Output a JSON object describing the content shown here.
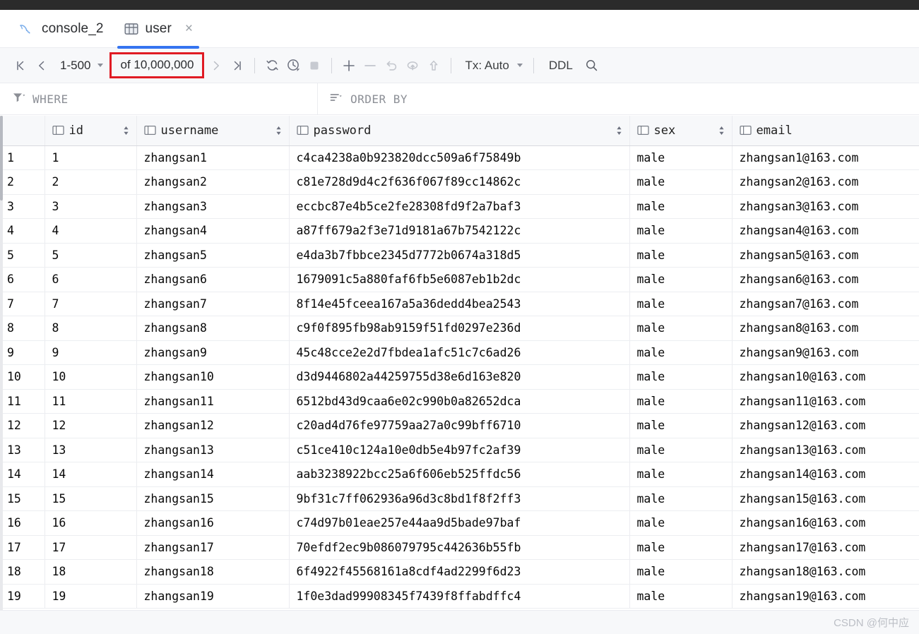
{
  "window": {
    "titlebar_color": "#2b2b2b",
    "accent_color": "#3574f0",
    "highlight_color": "#e01b24"
  },
  "tabs": [
    {
      "id": "console",
      "label": "console_2",
      "icon": "mysql-dolphin-icon",
      "active": false,
      "closable": false
    },
    {
      "id": "user",
      "label": "user",
      "icon": "table-icon",
      "active": true,
      "closable": true,
      "close_label": "×"
    }
  ],
  "toolbar": {
    "first_page_label": "|<",
    "prev_page_label": "<",
    "range_label": "1-500",
    "total_label": "of 10,000,000",
    "next_page_label": ">",
    "last_page_label": ">|",
    "refresh_label": "refresh",
    "history_label": "history",
    "stop_label": "stop",
    "add_row_label": "+",
    "delete_row_label": "−",
    "revert_label": "revert",
    "rollback_label": "rollback",
    "submit_label": "submit",
    "tx_label": "Tx: Auto",
    "ddl_label": "DDL",
    "search_label": "search"
  },
  "filters": {
    "where_label": "WHERE",
    "where_placeholder": "WHERE",
    "where_value": "",
    "orderby_label": "ORDER BY",
    "orderby_placeholder": "ORDER BY",
    "orderby_value": ""
  },
  "grid": {
    "columns": [
      {
        "key": "rownum",
        "label": "",
        "icon": "",
        "sortable": false
      },
      {
        "key": "id",
        "label": "id",
        "icon": "column-icon",
        "sortable": true,
        "align": "right"
      },
      {
        "key": "username",
        "label": "username",
        "icon": "column-icon",
        "sortable": true,
        "align": "left"
      },
      {
        "key": "password",
        "label": "password",
        "icon": "column-icon",
        "sortable": true,
        "align": "left"
      },
      {
        "key": "sex",
        "label": "sex",
        "icon": "column-icon",
        "sortable": true,
        "align": "left"
      },
      {
        "key": "email",
        "label": "email",
        "icon": "column-icon",
        "sortable": false,
        "align": "left"
      }
    ],
    "rows": [
      {
        "n": "1",
        "id": "1",
        "username": "zhangsan1",
        "password": "c4ca4238a0b923820dcc509a6f75849b",
        "sex": "male",
        "email": "zhangsan1@163.com"
      },
      {
        "n": "2",
        "id": "2",
        "username": "zhangsan2",
        "password": "c81e728d9d4c2f636f067f89cc14862c",
        "sex": "male",
        "email": "zhangsan2@163.com"
      },
      {
        "n": "3",
        "id": "3",
        "username": "zhangsan3",
        "password": "eccbc87e4b5ce2fe28308fd9f2a7baf3",
        "sex": "male",
        "email": "zhangsan3@163.com"
      },
      {
        "n": "4",
        "id": "4",
        "username": "zhangsan4",
        "password": "a87ff679a2f3e71d9181a67b7542122c",
        "sex": "male",
        "email": "zhangsan4@163.com"
      },
      {
        "n": "5",
        "id": "5",
        "username": "zhangsan5",
        "password": "e4da3b7fbbce2345d7772b0674a318d5",
        "sex": "male",
        "email": "zhangsan5@163.com"
      },
      {
        "n": "6",
        "id": "6",
        "username": "zhangsan6",
        "password": "1679091c5a880faf6fb5e6087eb1b2dc",
        "sex": "male",
        "email": "zhangsan6@163.com"
      },
      {
        "n": "7",
        "id": "7",
        "username": "zhangsan7",
        "password": "8f14e45fceea167a5a36dedd4bea2543",
        "sex": "male",
        "email": "zhangsan7@163.com"
      },
      {
        "n": "8",
        "id": "8",
        "username": "zhangsan8",
        "password": "c9f0f895fb98ab9159f51fd0297e236d",
        "sex": "male",
        "email": "zhangsan8@163.com"
      },
      {
        "n": "9",
        "id": "9",
        "username": "zhangsan9",
        "password": "45c48cce2e2d7fbdea1afc51c7c6ad26",
        "sex": "male",
        "email": "zhangsan9@163.com"
      },
      {
        "n": "10",
        "id": "10",
        "username": "zhangsan10",
        "password": "d3d9446802a44259755d38e6d163e820",
        "sex": "male",
        "email": "zhangsan10@163.com"
      },
      {
        "n": "11",
        "id": "11",
        "username": "zhangsan11",
        "password": "6512bd43d9caa6e02c990b0a82652dca",
        "sex": "male",
        "email": "zhangsan11@163.com"
      },
      {
        "n": "12",
        "id": "12",
        "username": "zhangsan12",
        "password": "c20ad4d76fe97759aa27a0c99bff6710",
        "sex": "male",
        "email": "zhangsan12@163.com"
      },
      {
        "n": "13",
        "id": "13",
        "username": "zhangsan13",
        "password": "c51ce410c124a10e0db5e4b97fc2af39",
        "sex": "male",
        "email": "zhangsan13@163.com"
      },
      {
        "n": "14",
        "id": "14",
        "username": "zhangsan14",
        "password": "aab3238922bcc25a6f606eb525ffdc56",
        "sex": "male",
        "email": "zhangsan14@163.com"
      },
      {
        "n": "15",
        "id": "15",
        "username": "zhangsan15",
        "password": "9bf31c7ff062936a96d3c8bd1f8f2ff3",
        "sex": "male",
        "email": "zhangsan15@163.com"
      },
      {
        "n": "16",
        "id": "16",
        "username": "zhangsan16",
        "password": "c74d97b01eae257e44aa9d5bade97baf",
        "sex": "male",
        "email": "zhangsan16@163.com"
      },
      {
        "n": "17",
        "id": "17",
        "username": "zhangsan17",
        "password": "70efdf2ec9b086079795c442636b55fb",
        "sex": "male",
        "email": "zhangsan17@163.com"
      },
      {
        "n": "18",
        "id": "18",
        "username": "zhangsan18",
        "password": "6f4922f45568161a8cdf4ad2299f6d23",
        "sex": "male",
        "email": "zhangsan18@163.com"
      },
      {
        "n": "19",
        "id": "19",
        "username": "zhangsan19",
        "password": "1f0e3dad99908345f7439f8ffabdffc4",
        "sex": "male",
        "email": "zhangsan19@163.com"
      }
    ]
  },
  "watermark": {
    "text": "CSDN @何中应"
  }
}
